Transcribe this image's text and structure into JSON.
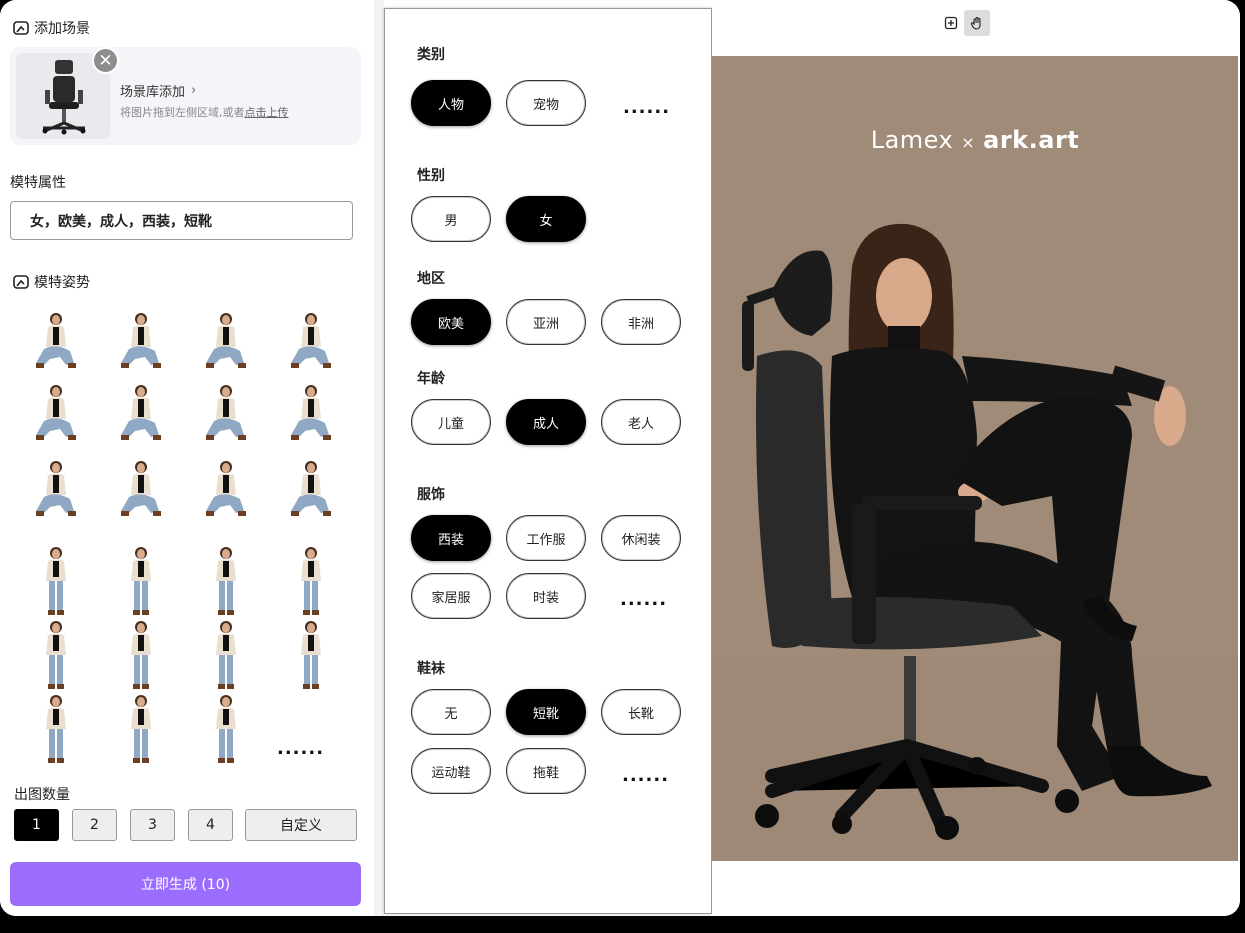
{
  "left": {
    "scene_title": "添加场景",
    "scene_link": "场景库添加",
    "scene_hint_prefix": "将图片拖到左侧区域,或者",
    "scene_hint_link": "点击上传",
    "attr_title": "模特属性",
    "attr_value": "女，欧美，成人，西装，短靴",
    "pose_title": "模特姿势",
    "pose_more": "......",
    "count_title": "出图数量",
    "count_options": [
      "1",
      "2",
      "3",
      "4",
      "自定义"
    ],
    "count_selected": "1",
    "generate_label": "立即生成 (10)",
    "accent_color": "#9b6dff"
  },
  "filters": {
    "category": {
      "label": "类别",
      "options": [
        "人物",
        "宠物"
      ],
      "selected": "人物",
      "more": "......"
    },
    "gender": {
      "label": "性别",
      "options": [
        "男",
        "女"
      ],
      "selected": "女"
    },
    "region": {
      "label": "地区",
      "options": [
        "欧美",
        "亚洲",
        "非洲"
      ],
      "selected": "欧美"
    },
    "age": {
      "label": "年龄",
      "options": [
        "儿童",
        "成人",
        "老人"
      ],
      "selected": "成人"
    },
    "clothing": {
      "label": "服饰",
      "options": [
        "西装",
        "工作服",
        "休闲装",
        "家居服",
        "时装"
      ],
      "selected": "西装",
      "more": "......"
    },
    "shoes": {
      "label": "鞋袜",
      "options": [
        "无",
        "短靴",
        "长靴",
        "运动鞋",
        "拖鞋"
      ],
      "selected": "短靴",
      "more": "......"
    }
  },
  "preview": {
    "brand_left": "Lamex",
    "brand_sep": "×",
    "brand_right": "ark.art",
    "tools": [
      "fit-screen-icon",
      "hand-icon"
    ]
  }
}
